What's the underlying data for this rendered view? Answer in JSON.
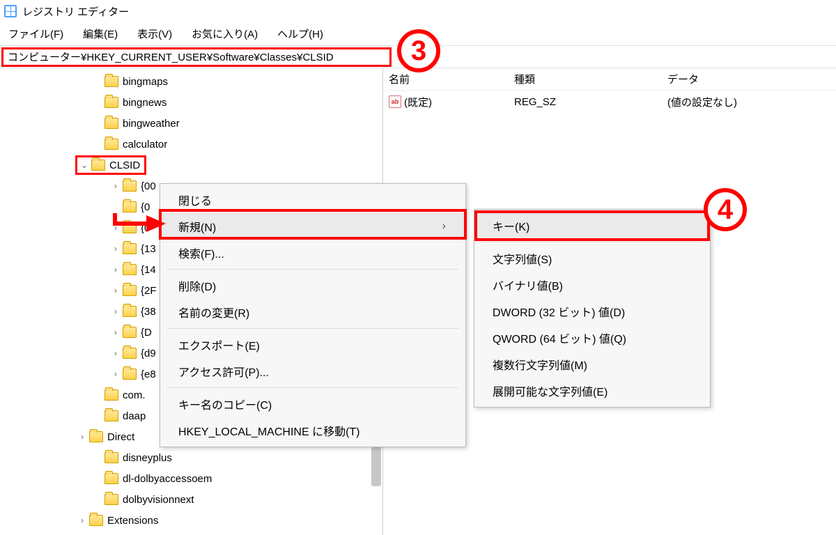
{
  "window": {
    "title": "レジストリ エディター"
  },
  "menubar": {
    "file": "ファイル(F)",
    "edit": "編集(E)",
    "view": "表示(V)",
    "favorites": "お気に入り(A)",
    "help": "ヘルプ(H)"
  },
  "address": {
    "path": "コンピューター¥HKEY_CURRENT_USER¥Software¥Classes¥CLSID"
  },
  "tree": {
    "rows": [
      {
        "label": "bingmaps",
        "indent": "ind0",
        "expander": ""
      },
      {
        "label": "bingnews",
        "indent": "ind0",
        "expander": ""
      },
      {
        "label": "bingweather",
        "indent": "ind0",
        "expander": ""
      },
      {
        "label": "calculator",
        "indent": "ind0",
        "expander": ""
      }
    ],
    "clsid": {
      "label": "CLSID",
      "expander": "⌄"
    },
    "sub": [
      {
        "label": "{00",
        "expander": "›"
      },
      {
        "label": "{0",
        "expander": ""
      },
      {
        "label": "{0",
        "expander": "›"
      },
      {
        "label": "{13",
        "expander": "›"
      },
      {
        "label": "{14",
        "expander": "›"
      },
      {
        "label": "{2F",
        "expander": "›"
      },
      {
        "label": "{38",
        "expander": "›"
      },
      {
        "label": "{D",
        "expander": "›"
      },
      {
        "label": "{d9",
        "expander": "›"
      },
      {
        "label": "{e8",
        "expander": "›"
      }
    ],
    "after": [
      {
        "label": "com.",
        "indent": "ind0",
        "expander": ""
      },
      {
        "label": "daap",
        "indent": "ind0",
        "expander": ""
      },
      {
        "label": "Direct",
        "indent": "ind2",
        "expander": "›"
      },
      {
        "label": "disneyplus",
        "indent": "ind0",
        "expander": ""
      },
      {
        "label": "dl-dolbyaccessoem",
        "indent": "ind0",
        "expander": ""
      },
      {
        "label": "dolbyvisionnext",
        "indent": "ind0",
        "expander": ""
      },
      {
        "label": "Extensions",
        "indent": "ind2",
        "expander": "›"
      }
    ]
  },
  "values": {
    "headers": {
      "name": "名前",
      "type": "種類",
      "data": "データ"
    },
    "rows": [
      {
        "name": "(既定)",
        "type": "REG_SZ",
        "data": "(値の設定なし)"
      }
    ]
  },
  "context1": {
    "close": "閉じる",
    "new": "新規(N)",
    "find": "検索(F)...",
    "delete": "削除(D)",
    "rename": "名前の変更(R)",
    "export": "エクスポート(E)",
    "permissions": "アクセス許可(P)...",
    "copyKeyName": "キー名のコピー(C)",
    "gotoHKLM": "HKEY_LOCAL_MACHINE に移動(T)"
  },
  "context2": {
    "key": "キー(K)",
    "string": "文字列値(S)",
    "binary": "バイナリ値(B)",
    "dword": "DWORD (32 ビット) 値(D)",
    "qword": "QWORD (64 ビット) 値(Q)",
    "multiString": "複数行文字列値(M)",
    "expandString": "展開可能な文字列値(E)"
  },
  "callouts": {
    "n3": "3",
    "n4": "4"
  }
}
